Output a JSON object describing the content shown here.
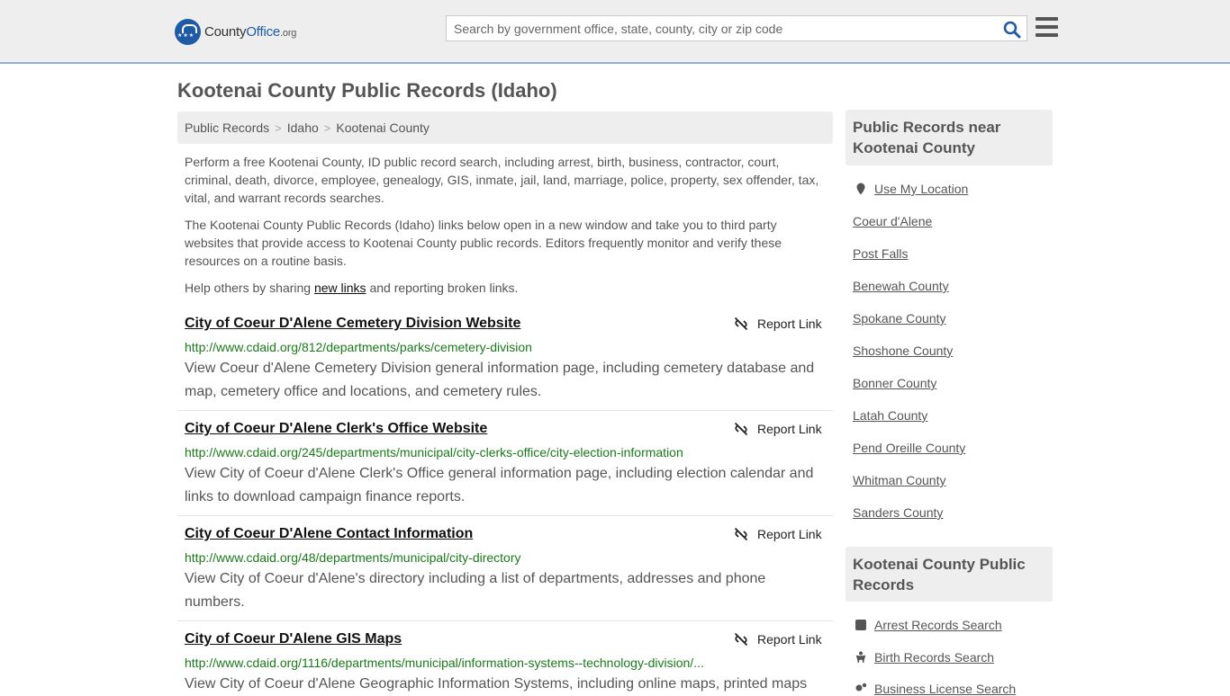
{
  "header": {
    "logo_main": "County",
    "logo_brand": "Office",
    "logo_org": ".org",
    "search_placeholder": "Search by government office, state, county, city or zip code"
  },
  "page_title": "Kootenai County Public Records (Idaho)",
  "breadcrumb": [
    "Public Records",
    "Idaho",
    "Kootenai County"
  ],
  "intro": {
    "p1": "Perform a free Kootenai County, ID public record search, including arrest, birth, business, contractor, court, criminal, death, divorce, employee, genealogy, GIS, inmate, jail, land, marriage, police, property, sex offender, tax, vital, and warrant records searches.",
    "p2": "The Kootenai County Public Records (Idaho) links below open in a new window and take you to third party websites that provide access to Kootenai County public records. Editors frequently monitor and verify these resources on a routine basis.",
    "p3_before": "Help others by sharing ",
    "p3_link": "new links",
    "p3_after": " and reporting broken links."
  },
  "report_label": "Report Link",
  "results": [
    {
      "title": "City of Coeur D'Alene Cemetery Division Website",
      "url": "http://www.cdaid.org/812/departments/parks/cemetery-division",
      "desc": "View Coeur d'Alene Cemetery Division general information page, including cemetery database and map, cemetery office and locations, and cemetery rules."
    },
    {
      "title": "City of Coeur D'Alene Clerk's Office Website",
      "url": "http://www.cdaid.org/245/departments/municipal/city-clerks-office/city-election-information",
      "desc": "View City of Coeur d'Alene Clerk's Office general information page, including election calendar and links to download campaign finance reports."
    },
    {
      "title": "City of Coeur D'Alene Contact Information",
      "url": "http://www.cdaid.org/48/departments/municipal/city-directory",
      "desc": "View City of Coeur d'Alene's directory including a list of departments, addresses and phone numbers."
    },
    {
      "title": "City of Coeur D'Alene GIS Maps",
      "url": "http://www.cdaid.org/1116/departments/municipal/information-systems--technology-division/...",
      "desc": "View City of Coeur d'Alene Geographic Information Systems, including online maps, printed maps"
    }
  ],
  "sidebar": {
    "near_heading": "Public Records near Kootenai County",
    "use_location": "Use My Location",
    "near_links": [
      "Coeur d'Alene",
      "Post Falls",
      "Benewah County",
      "Spokane County",
      "Shoshone County",
      "Bonner County",
      "Latah County",
      "Pend Oreille County",
      "Whitman County",
      "Sanders County"
    ],
    "records_heading": "Kootenai County Public Records",
    "record_links": [
      "Arrest Records Search",
      "Birth Records Search",
      "Business License Search"
    ]
  }
}
